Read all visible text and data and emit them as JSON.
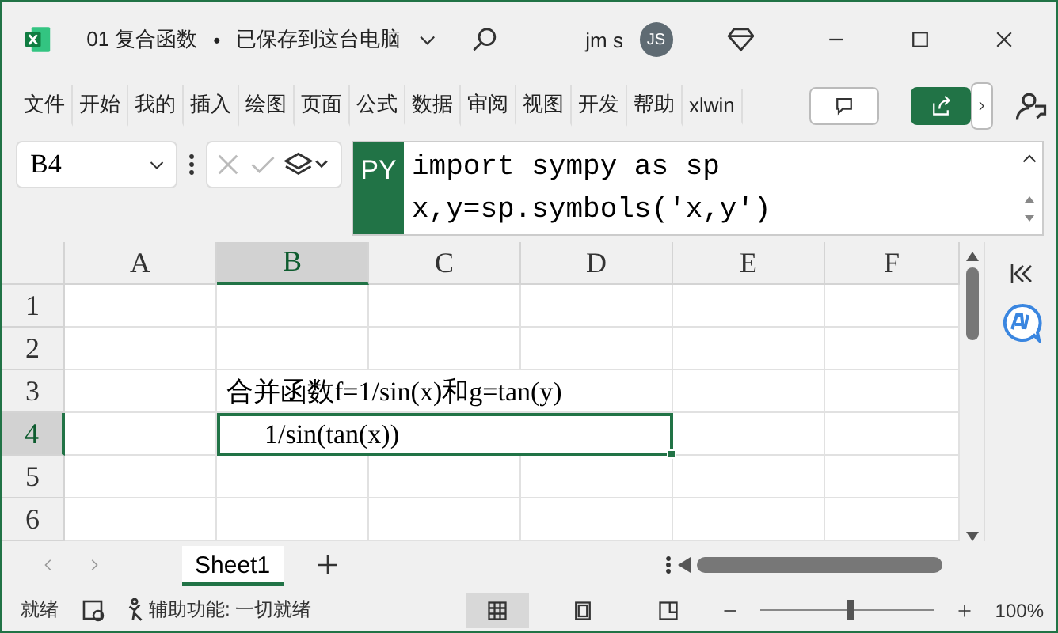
{
  "title_bar": {
    "file_name": "01 复合函数",
    "separator": "•",
    "save_status": "已保存到这台电脑",
    "user_name": "jm s",
    "avatar_initials": "JS"
  },
  "ribbon_tabs": [
    {
      "label": "文件",
      "selected": false
    },
    {
      "label": "开始",
      "selected": false
    },
    {
      "label": "我的",
      "selected": false
    },
    {
      "label": "插入",
      "selected": false
    },
    {
      "label": "绘图",
      "selected": false
    },
    {
      "label": "页面",
      "selected": false
    },
    {
      "label": "公式",
      "selected": false
    },
    {
      "label": "数据",
      "selected": false
    },
    {
      "label": "审阅",
      "selected": false
    },
    {
      "label": "视图",
      "selected": false
    },
    {
      "label": "开发",
      "selected": false
    },
    {
      "label": "帮助",
      "selected": false
    },
    {
      "label": "xlwin",
      "selected": false
    }
  ],
  "formula_bar": {
    "name_box": "B4",
    "badge": "PY",
    "code_lines": [
      "import sympy as sp",
      "x,y=sp.symbols('x,y')"
    ]
  },
  "sheet": {
    "columns": [
      {
        "label": "A",
        "selected": false
      },
      {
        "label": "B",
        "selected": true
      },
      {
        "label": "C",
        "selected": false
      },
      {
        "label": "D",
        "selected": false
      },
      {
        "label": "E",
        "selected": false
      },
      {
        "label": "F",
        "selected": false
      }
    ],
    "rows": [
      {
        "label": "1",
        "selected": false
      },
      {
        "label": "2",
        "selected": false
      },
      {
        "label": "3",
        "selected": false,
        "content": "合并函数f=1/sin(x)和g=tan(y)",
        "indented": false
      },
      {
        "label": "4",
        "selected": true,
        "content": "1/sin(tan(x))",
        "indented": true
      },
      {
        "label": "5",
        "selected": false
      },
      {
        "label": "6",
        "selected": false
      }
    ]
  },
  "sheet_tabs": [
    {
      "label": "Sheet1",
      "selected": true
    }
  ],
  "status_bar": {
    "ready": "就绪",
    "accessibility": "辅助功能: 一切就绪",
    "view_modes": [
      {
        "kind": "normal",
        "selected": true
      },
      {
        "kind": "layout",
        "selected": false
      },
      {
        "kind": "pagebreak",
        "selected": false
      }
    ],
    "zoom": {
      "level": 0.5,
      "reading": "100%"
    }
  }
}
